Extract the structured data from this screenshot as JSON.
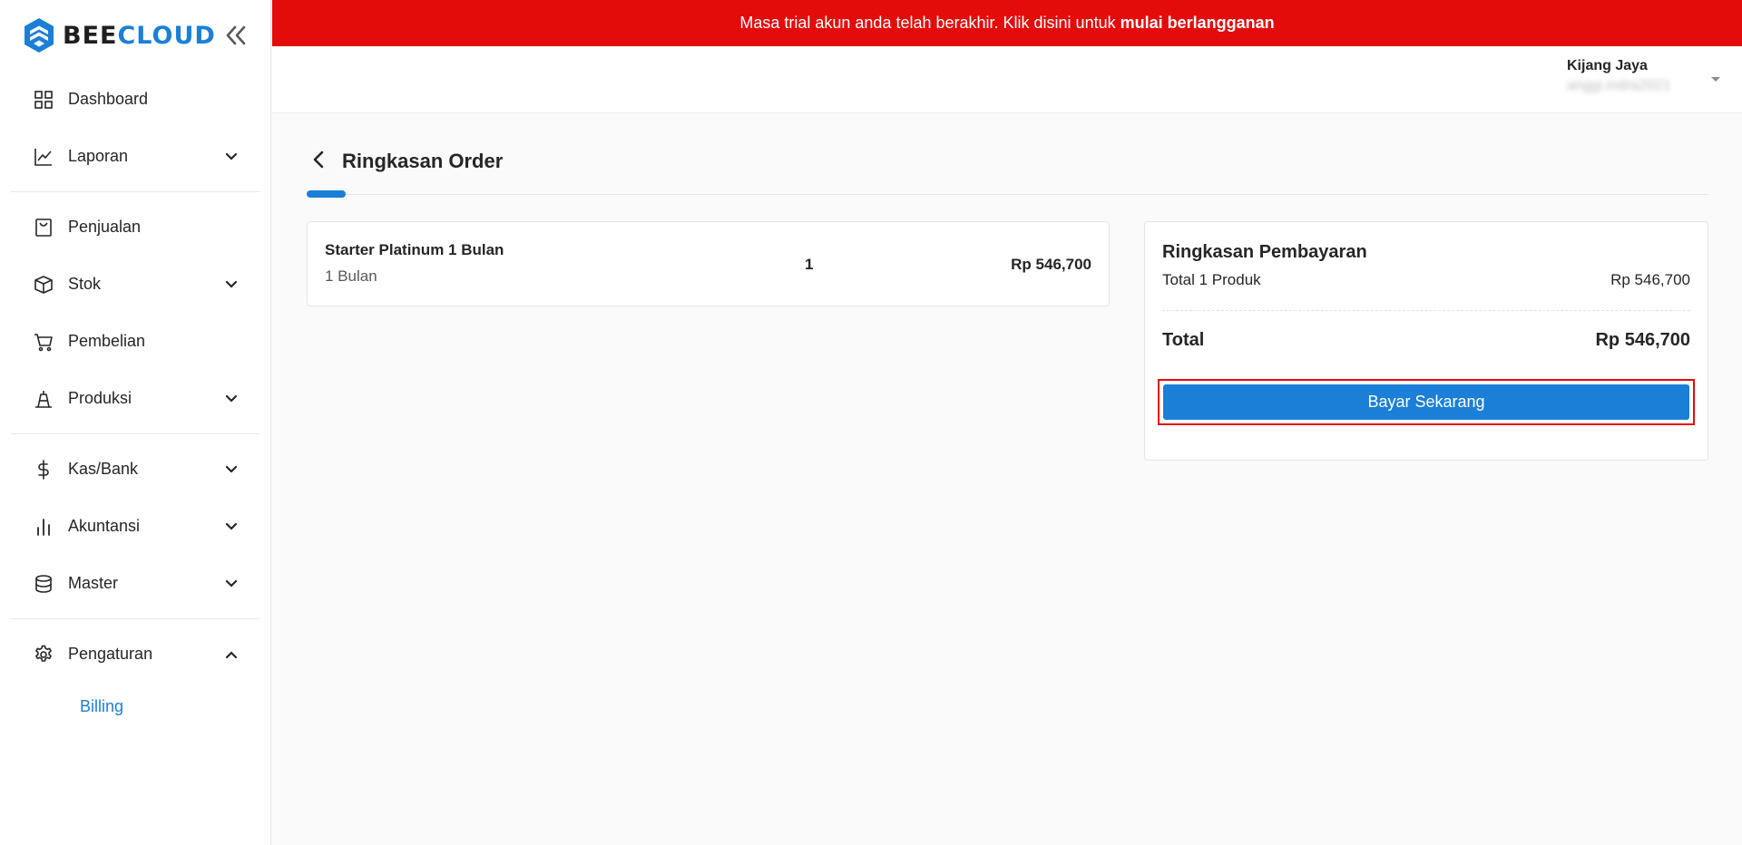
{
  "brand": {
    "bee": "BEE",
    "cloud": "CLOUD",
    "primary_color": "#1b7fd8"
  },
  "banner": {
    "text": "Masa trial akun anda telah berakhir. Klik disini untuk",
    "link_text": "mulai berlangganan",
    "color": "#e40b0b"
  },
  "sidebar": {
    "collapse_icon": "double-chevron-left-icon",
    "items": [
      {
        "label": "Dashboard",
        "icon": "grid-icon"
      },
      {
        "label": "Laporan",
        "icon": "line-chart-icon",
        "expandable": true
      },
      {
        "label": "Penjualan",
        "icon": "shopping-bag-icon"
      },
      {
        "label": "Stok",
        "icon": "box-icon",
        "expandable": true
      },
      {
        "label": "Pembelian",
        "icon": "cart-icon"
      },
      {
        "label": "Produksi",
        "icon": "production-icon",
        "expandable": true
      },
      {
        "label": "Kas/Bank",
        "icon": "dollar-icon",
        "expandable": true
      },
      {
        "label": "Akuntansi",
        "icon": "bar-chart-icon",
        "expandable": true
      },
      {
        "label": "Master",
        "icon": "database-icon",
        "expandable": true
      },
      {
        "label": "Pengaturan",
        "icon": "gear-icon",
        "expandable": true,
        "expanded": true
      }
    ],
    "submenu": {
      "label": "Billing"
    }
  },
  "header": {
    "user_name": "Kijang Jaya",
    "user_email": "anggi.indra2021"
  },
  "page": {
    "title": "Ringkasan Order"
  },
  "order": {
    "product_name": "Starter Platinum 1 Bulan",
    "period": "1 Bulan",
    "qty": "1",
    "price": "Rp 546,700"
  },
  "summary": {
    "title": "Ringkasan Pembayaran",
    "row_label": "Total 1 Produk",
    "row_value": "Rp 546,700",
    "total_label": "Total",
    "total_value": "Rp 546,700",
    "pay_label": "Bayar Sekarang"
  }
}
